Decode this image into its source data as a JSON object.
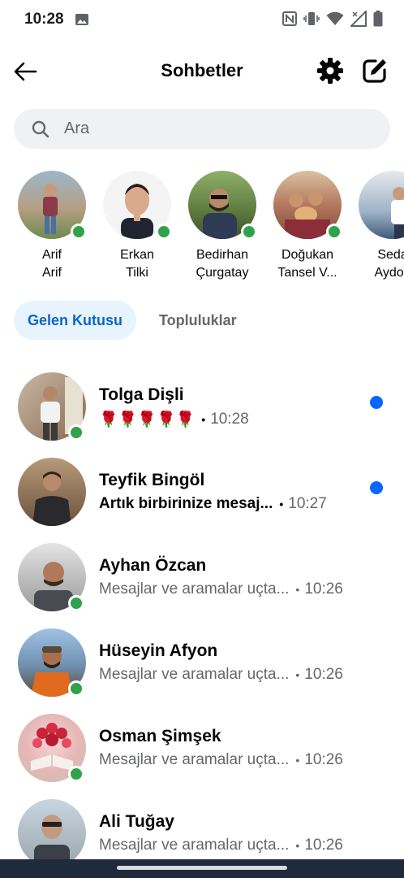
{
  "status_bar": {
    "time": "10:28",
    "icons": [
      "image-icon",
      "nfc-icon",
      "vibrate-icon",
      "wifi-icon",
      "signal-icon",
      "battery-icon"
    ]
  },
  "header": {
    "title": "Sohbetler",
    "back_icon": "arrow-left-icon",
    "settings_icon": "gear-icon",
    "compose_icon": "compose-icon"
  },
  "search": {
    "placeholder": "Ara"
  },
  "stories": [
    {
      "first": "Arif",
      "second": "Arif",
      "online": true,
      "color": "#9c8a75"
    },
    {
      "first": "Erkan",
      "second": "Tilki",
      "online": true,
      "color": "#c9a48b"
    },
    {
      "first": "Bedirhan",
      "second": "Çurgatay",
      "online": true,
      "color": "#6f7a55"
    },
    {
      "first": "Doğukan",
      "second": "Tansel V...",
      "online": true,
      "color": "#a9725f"
    },
    {
      "first": "Seda",
      "second": "Aydog",
      "online": false,
      "color": "#5a6f8a"
    }
  ],
  "tabs": {
    "inbox": "Gelen Kutusu",
    "communities": "Topluluklar"
  },
  "chats": [
    {
      "name": "Tolga Dişli",
      "preview": "🌹🌹🌹🌹🌹",
      "time": "10:28",
      "unread": true,
      "online": true,
      "color": "#5e4a3c"
    },
    {
      "name": "Teyfik Bingöl",
      "preview": "Artık birbirinize mesaj...",
      "time": "10:27",
      "unread": true,
      "online": false,
      "color": "#7a5a40"
    },
    {
      "name": "Ayhan Özcan",
      "preview": "Mesajlar ve aramalar uçta...",
      "time": "10:26",
      "unread": false,
      "online": true,
      "color": "#8d8070"
    },
    {
      "name": "Hüseyin Afyon",
      "preview": "Mesajlar ve aramalar uçta...",
      "time": "10:26",
      "unread": false,
      "online": true,
      "color": "#c2662e"
    },
    {
      "name": "Osman Şimşek",
      "preview": "Mesajlar ve aramalar uçta...",
      "time": "10:26",
      "unread": false,
      "online": true,
      "color": "#c23a3a"
    },
    {
      "name": "Ali Tuğay",
      "preview": "Mesajlar ve aramalar uçta...",
      "time": "10:26",
      "unread": false,
      "online": false,
      "color": "#8a8f92"
    }
  ],
  "colors": {
    "accent_blue": "#0866ff",
    "tab_active_bg": "#e7f3ff",
    "tab_active_text": "#0a66c8",
    "online_green": "#31a24c",
    "secondary_text": "#65676b",
    "search_bg": "#eff1f4"
  }
}
